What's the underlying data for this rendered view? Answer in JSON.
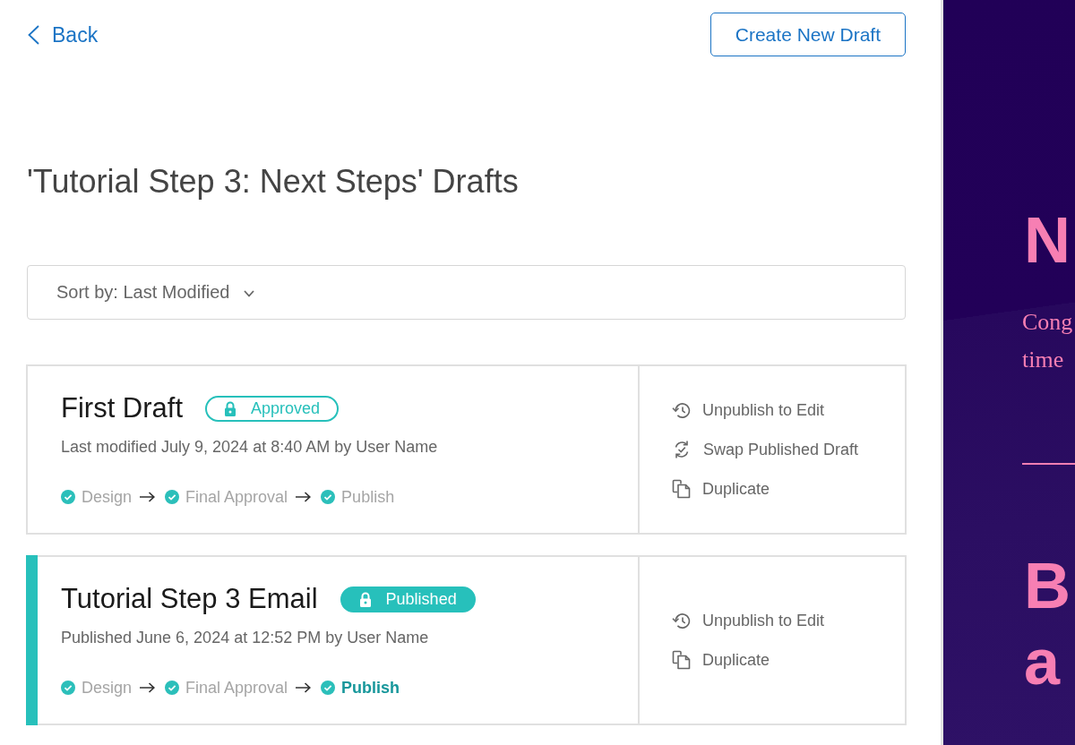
{
  "back_link": {
    "label": "Back"
  },
  "create_button": {
    "label": "Create New Draft"
  },
  "page_title": "'Tutorial Step 3: Next Steps' Drafts",
  "sort": {
    "label": "Sort by: Last Modified"
  },
  "drafts": [
    {
      "title": "First Draft",
      "status": {
        "kind": "approved",
        "label": "Approved"
      },
      "published": false,
      "meta": "Last modified July 9, 2024 at 8:40 AM by User Name",
      "steps": [
        {
          "label": "Design",
          "done": true,
          "active": false
        },
        {
          "label": "Final Approval",
          "done": true,
          "active": false
        },
        {
          "label": "Publish",
          "done": true,
          "active": false
        }
      ],
      "actions": [
        {
          "kind": "unpublish",
          "label": "Unpublish to Edit"
        },
        {
          "kind": "swap",
          "label": "Swap Published Draft"
        },
        {
          "kind": "duplicate",
          "label": "Duplicate"
        }
      ]
    },
    {
      "title": "Tutorial Step 3 Email",
      "status": {
        "kind": "published",
        "label": "Published"
      },
      "published": true,
      "meta": "Published June 6, 2024 at 12:52 PM by User Name",
      "steps": [
        {
          "label": "Design",
          "done": true,
          "active": false
        },
        {
          "label": "Final Approval",
          "done": true,
          "active": false
        },
        {
          "label": "Publish",
          "done": true,
          "active": true
        }
      ],
      "actions": [
        {
          "kind": "unpublish",
          "label": "Unpublish to Edit"
        },
        {
          "kind": "duplicate",
          "label": "Duplicate"
        }
      ]
    }
  ],
  "email_preview": {
    "heading": "N",
    "text_lines": [
      "Cong",
      "time"
    ],
    "heading_lines": [
      "B",
      "a"
    ]
  }
}
